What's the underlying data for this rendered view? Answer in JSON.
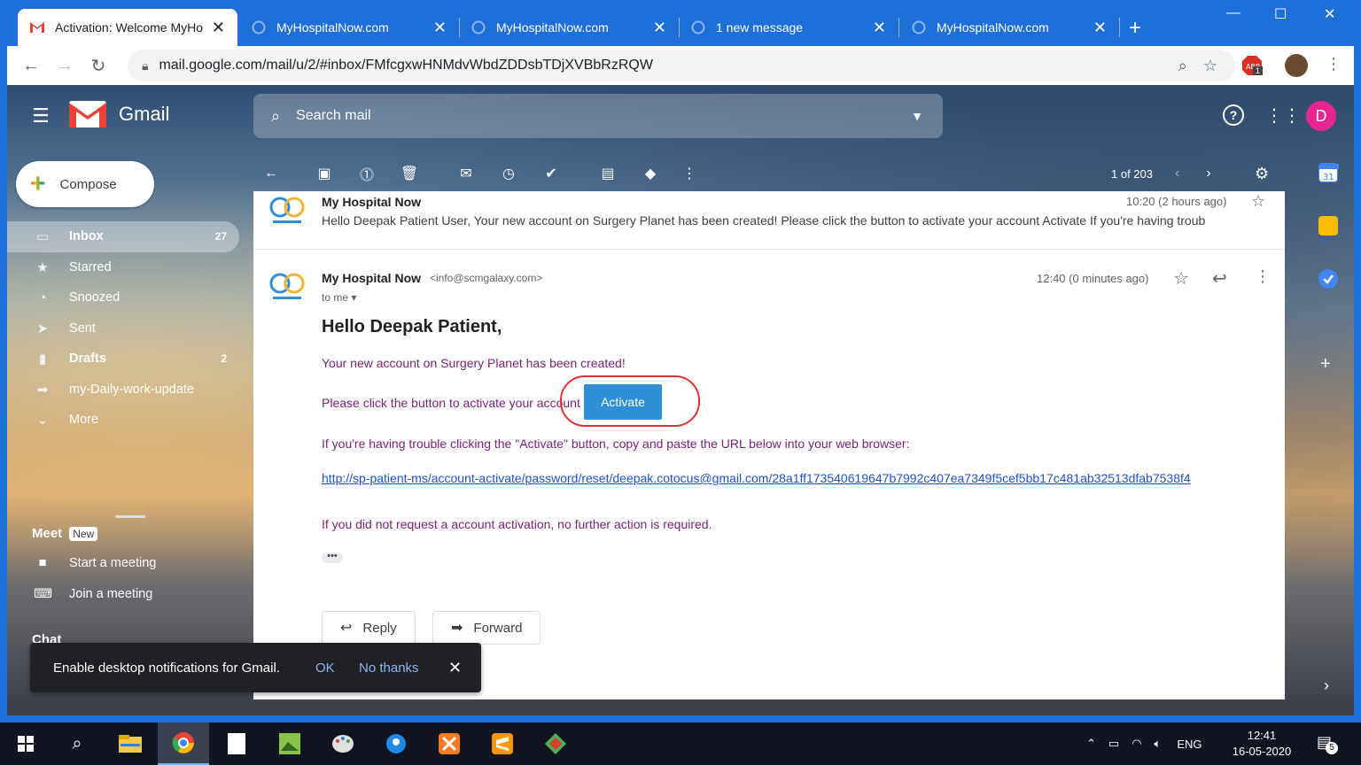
{
  "browser": {
    "tabs": [
      {
        "title": "Activation: Welcome MyHo",
        "active": true
      },
      {
        "title": "MyHospitalNow.com",
        "active": false
      },
      {
        "title": "MyHospitalNow.com",
        "active": false
      },
      {
        "title": "1 new message",
        "active": false
      },
      {
        "title": "MyHospitalNow.com",
        "active": false
      }
    ],
    "url": "mail.google.com/mail/u/2/#inbox/FMfcgxwHNMdvWbdZDDsbTDjXVBbRzRQW",
    "extension_badge": "1"
  },
  "gmail": {
    "logo_text": "Gmail",
    "search_placeholder": "Search mail",
    "avatar_letter": "D",
    "compose_label": "Compose",
    "nav": [
      {
        "label": "Inbox",
        "count": "27",
        "icon": "inbox-icon"
      },
      {
        "label": "Starred",
        "count": "",
        "icon": "star-icon"
      },
      {
        "label": "Snoozed",
        "count": "",
        "icon": "clock-icon"
      },
      {
        "label": "Sent",
        "count": "",
        "icon": "send-icon"
      },
      {
        "label": "Drafts",
        "count": "2",
        "icon": "draft-icon"
      },
      {
        "label": "my-Daily-work-update",
        "count": "",
        "icon": "label-icon"
      },
      {
        "label": "More",
        "count": "",
        "icon": "chevron-down-icon"
      }
    ],
    "meet": {
      "title": "Meet",
      "badge": "New",
      "items": [
        "Start a meeting",
        "Join a meeting"
      ]
    },
    "chat_title": "Chat",
    "pager": "1 of 203"
  },
  "thread": {
    "collapsed": {
      "sender": "My Hospital Now",
      "time": "10:20 (2 hours ago)",
      "snippet": "Hello Deepak Patient User, Your new account on Surgery Planet has been created! Please click the button to activate your account Activate If you're having troub"
    },
    "expanded": {
      "sender": "My Hospital Now",
      "email": "<info@scmgalaxy.com>",
      "to": "to me",
      "time": "12:40 (0 minutes ago)",
      "greeting": "Hello Deepak Patient,",
      "line1": "Your new account on Surgery Planet has been created!",
      "line2": "Please click the button to activate your account",
      "activate_label": "Activate",
      "line3": "If you're having trouble clicking the \"Activate\" button, copy and paste the URL below into your web browser:",
      "link": "http://sp-patient-ms/account-activate/password/reset/deepak.cotocus@gmail.com/28a1ff173540619647b7992c407ea7349f5cef5bb17c481ab32513dfab7538f4",
      "line4": "If you did not request a account activation, no further action is required."
    },
    "reply_label": "Reply",
    "forward_label": "Forward"
  },
  "toast": {
    "message": "Enable desktop notifications for Gmail.",
    "ok": "OK",
    "no_thanks": "No thanks"
  },
  "taskbar": {
    "lang": "ENG",
    "time": "12:41",
    "date": "16-05-2020",
    "notifications": "5"
  },
  "colors": {
    "chrome_blue": "#1e6fd9",
    "gmail_red": "#ea4335",
    "body_text_purple": "#7b1f7b",
    "link_blue": "#1a53cc",
    "activate_button": "#2f8fd6",
    "annotation_red": "#e03131",
    "avatar_pink": "#e52592"
  }
}
